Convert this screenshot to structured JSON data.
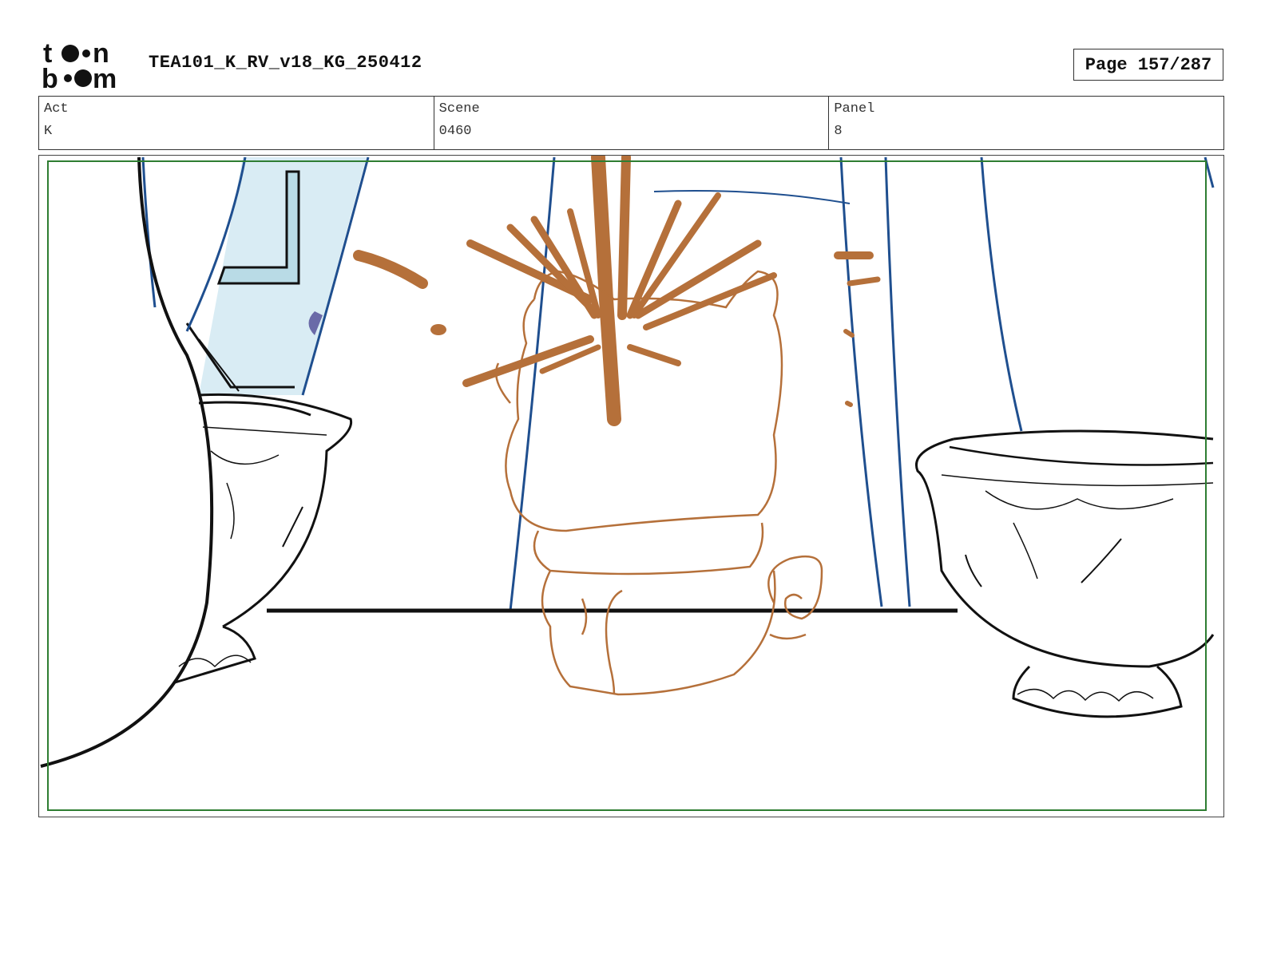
{
  "header": {
    "logo_text": "toon boom",
    "document_title": "TEA101_K_RV_v18_KG_250412",
    "page_label": "Page 157/287"
  },
  "info": {
    "act": {
      "label": "Act",
      "value": "K"
    },
    "scene": {
      "label": "Scene",
      "value": "0460"
    },
    "panel": {
      "label": "Panel",
      "value": "8"
    }
  },
  "artwork": {
    "description_icon": "storyboard-drawing",
    "colors": {
      "safe_frame": "#2e7d32",
      "curtain_blue": "#1f4f8f",
      "sketch_brown": "#b5703a",
      "ink": "#111111"
    }
  }
}
